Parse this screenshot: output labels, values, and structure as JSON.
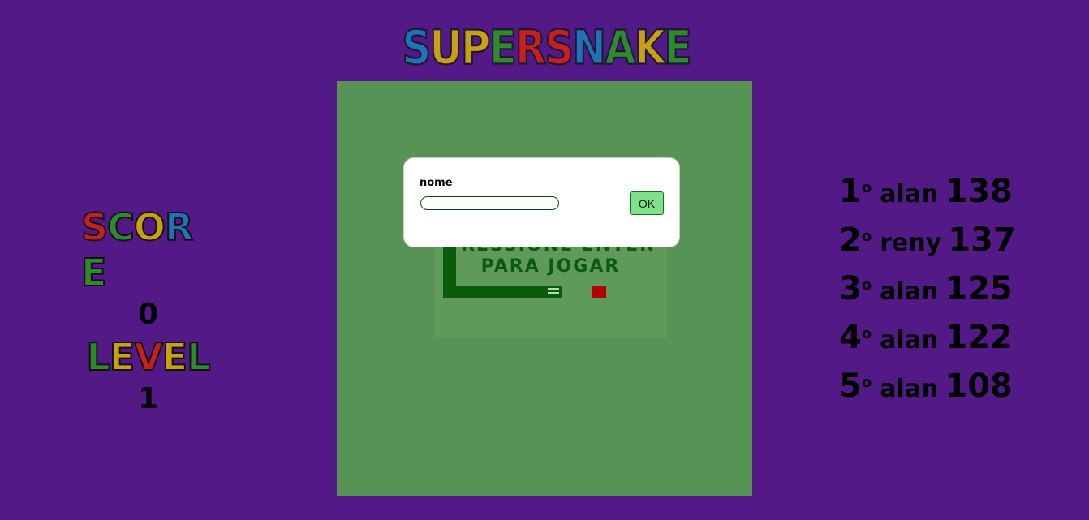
{
  "logo": {
    "letters": [
      {
        "ch": "S",
        "color": "#1e73b8"
      },
      {
        "ch": "U",
        "color": "#c9a012"
      },
      {
        "ch": "P",
        "color": "#c9a012"
      },
      {
        "ch": "E",
        "color": "#2f8a2f"
      },
      {
        "ch": "R",
        "color": "#c81e1e"
      },
      {
        "ch": "S",
        "color": "#c81e1e"
      },
      {
        "ch": "N",
        "color": "#1e73b8"
      },
      {
        "ch": "A",
        "color": "#2f8a2f"
      },
      {
        "ch": "K",
        "color": "#c9a012"
      },
      {
        "ch": "E",
        "color": "#2f8a2f"
      }
    ]
  },
  "stats": {
    "score_label": [
      {
        "ch": "S",
        "color": "#c81e1e"
      },
      {
        "ch": "C",
        "color": "#2f8a2f"
      },
      {
        "ch": "O",
        "color": "#c9a012"
      },
      {
        "ch": "R",
        "color": "#1e73b8"
      },
      {
        "ch": "E",
        "color": "#2f8a2f"
      }
    ],
    "score_value": "0",
    "level_label": [
      {
        "ch": "L",
        "color": "#2f8a2f"
      },
      {
        "ch": "E",
        "color": "#c9a012"
      },
      {
        "ch": "V",
        "color": "#c81e1e"
      },
      {
        "ch": "E",
        "color": "#c9a012"
      },
      {
        "ch": "L",
        "color": "#2f8a2f"
      }
    ],
    "level_value": "1"
  },
  "board": {
    "press_line1": "PRESSIONE ENTER",
    "press_line2": "PARA JOGAR"
  },
  "dialog": {
    "label": "nome",
    "input_value": "",
    "ok_label": "OK"
  },
  "ranking": [
    {
      "pos": "1",
      "ord": "o",
      "name": "alan",
      "score": "138"
    },
    {
      "pos": "2",
      "ord": "o",
      "name": "reny",
      "score": "137"
    },
    {
      "pos": "3",
      "ord": "o",
      "name": "alan",
      "score": "125"
    },
    {
      "pos": "4",
      "ord": "o",
      "name": "alan",
      "score": "122"
    },
    {
      "pos": "5",
      "ord": "o",
      "name": "alan",
      "score": "108"
    }
  ]
}
